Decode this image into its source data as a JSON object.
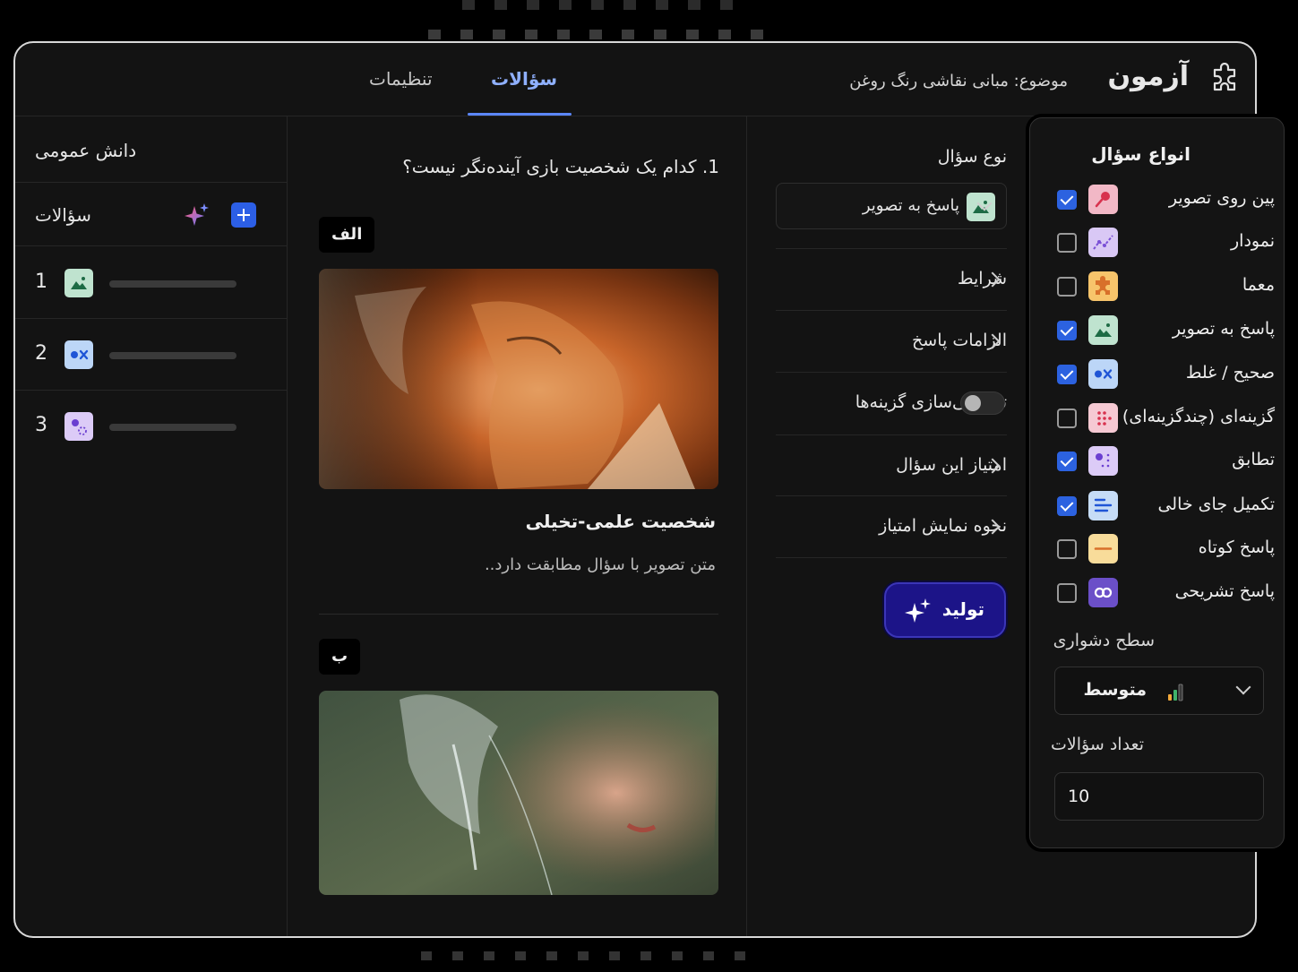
{
  "header": {
    "app_title": "آزمون",
    "topic": "موضوع: مبانی نقاشی رنگ روغن",
    "tabs": [
      {
        "label": "سؤالات",
        "active": true
      },
      {
        "label": "تنظیمات",
        "active": false
      }
    ]
  },
  "sidebar": {
    "title": "دانش عمومی",
    "questions_label": "سؤالات",
    "items": [
      {
        "number": "1",
        "icon": "image-answer-icon"
      },
      {
        "number": "2",
        "icon": "true-false-icon"
      },
      {
        "number": "3",
        "icon": "matching-icon"
      }
    ]
  },
  "question": {
    "text": "1. کدام یک شخصیت بازی آینده‌نگر نیست؟",
    "options": [
      {
        "label": "الف",
        "title": "شخصیت علمی-تخیلی",
        "description": "متن تصویر با سؤال مطابقت دارد.."
      },
      {
        "label": "ب"
      }
    ]
  },
  "settings": {
    "question_type_label": "نوع سؤال",
    "question_type_value": "پاسخ به تصویر",
    "rows": {
      "conditions": "شرایط",
      "answer_requirements": "الزامات پاسخ",
      "shuffle_options": "تصادفی‌سازی گزینه‌ها",
      "question_score": "امتیاز این سؤال",
      "score_display": "نحوه نمایش امتیاز"
    },
    "shuffle_enabled": false,
    "generate_label": "تولید"
  },
  "panel": {
    "title": "انواع سؤال",
    "types": [
      {
        "label": "پین روی تصویر",
        "checked": true,
        "icon": "pin-icon",
        "color": "#f2b8c6"
      },
      {
        "label": "نمودار",
        "checked": false,
        "icon": "chart-icon",
        "color": "#d9c8f5"
      },
      {
        "label": "معما",
        "checked": false,
        "icon": "puzzle-icon",
        "color": "#f7c46b"
      },
      {
        "label": "پاسخ به تصویر",
        "checked": true,
        "icon": "image-answer-icon",
        "color": "#bfe3cf"
      },
      {
        "label": "صحیح / غلط",
        "checked": true,
        "icon": "true-false-icon",
        "color": "#bcd6f7"
      },
      {
        "label": "گزینه‌ای (چندگزینه‌ای)",
        "checked": false,
        "icon": "multiple-choice-icon",
        "color": "#f6c9d3"
      },
      {
        "label": "تطابق",
        "checked": true,
        "icon": "matching-icon",
        "color": "#dccbf7"
      },
      {
        "label": "تکمیل جای خالی",
        "checked": true,
        "icon": "fill-blank-icon",
        "color": "#c6dcf6"
      },
      {
        "label": "پاسخ کوتاه",
        "checked": false,
        "icon": "short-answer-icon",
        "color": "#f8dc9a"
      },
      {
        "label": "پاسخ تشریحی",
        "checked": false,
        "icon": "essay-icon",
        "color": "#6b4fc8"
      }
    ],
    "difficulty_label": "سطح دشواری",
    "difficulty_value": "متوسط",
    "count_label": "تعداد سؤالات",
    "count_value": "10"
  },
  "colors": {
    "accent": "#5b87ff",
    "generate_button": "#1c1488",
    "checkbox_checked": "#2c62e0"
  }
}
